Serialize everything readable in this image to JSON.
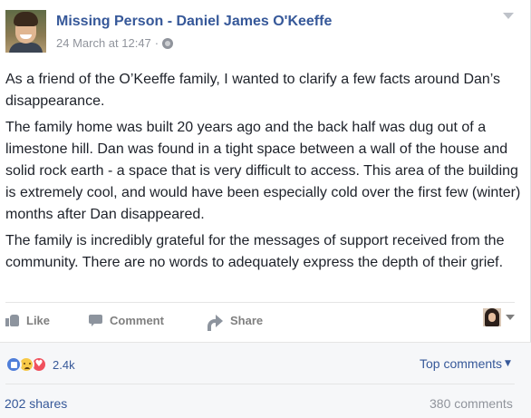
{
  "post": {
    "author": "Missing Person - Daniel James O'Keeffe",
    "timestamp": "24 March at 12:47",
    "separator": "·",
    "privacy_icon": "globe-icon",
    "paragraphs": [
      "As a friend of the O’Keeffe family, I wanted to clarify a few facts around Dan’s disappearance.",
      "The family home was built 20 years ago and the back half was dug out of a limestone hill. Dan was found in a tight space between a wall of the house and solid rock earth - a space that is very difficult to access. This area of the building is extremely cool, and would have been especially cold over the first few (winter) months after Dan disappeared.",
      "The family is incredibly grateful for the messages of support received from the community. There are no words to adequately express the depth of their grief."
    ]
  },
  "actions": {
    "like": "Like",
    "comment": "Comment",
    "share": "Share"
  },
  "footer": {
    "reaction_icons": [
      "like-reaction-icon",
      "sad-reaction-icon",
      "love-reaction-icon"
    ],
    "reaction_count": "2.4k",
    "sort_label": "Top comments",
    "shares": "202 shares",
    "comments": "380 comments"
  },
  "colors": {
    "link_blue": "#365899",
    "muted_gray": "#90949c",
    "footer_bg": "#f6f7f9"
  }
}
